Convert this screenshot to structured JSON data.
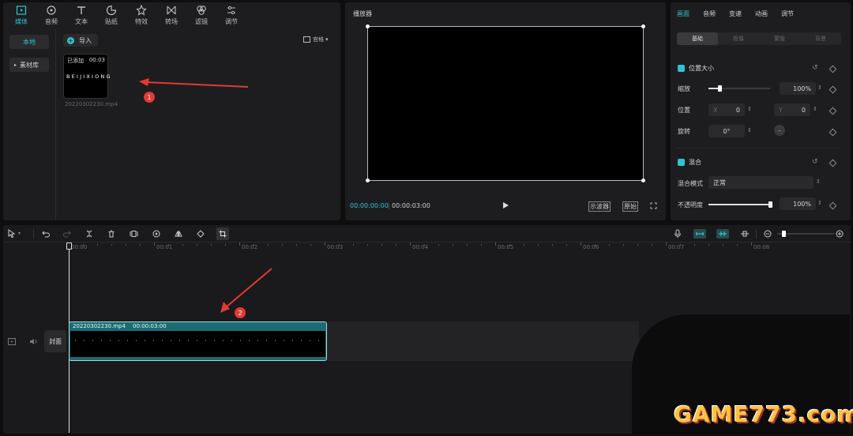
{
  "toolbar": {
    "tabs": [
      {
        "label": "媒体",
        "icon": "media-icon"
      },
      {
        "label": "音频",
        "icon": "audio-icon"
      },
      {
        "label": "文本",
        "icon": "text-icon"
      },
      {
        "label": "贴纸",
        "icon": "sticker-icon"
      },
      {
        "label": "特效",
        "icon": "effects-icon"
      },
      {
        "label": "转场",
        "icon": "transition-icon"
      },
      {
        "label": "滤镜",
        "icon": "filter-icon"
      },
      {
        "label": "调节",
        "icon": "adjust-icon"
      }
    ]
  },
  "media": {
    "sidebar": {
      "local": "本地",
      "library": "素材库"
    },
    "import_label": "导入",
    "view_label": "宫格",
    "clip": {
      "badge": "已添加",
      "duration": "00:03",
      "thumb_text": "BEIJIXIONG",
      "filename": "20220302230.mp4"
    },
    "annotation_1": "1"
  },
  "player": {
    "title": "播放器",
    "current_time": "00:00:00:00",
    "total_time": "00:00:03:00",
    "btn_scope": "示波器",
    "btn_original": "原始"
  },
  "inspector": {
    "tabs": [
      "画面",
      "音频",
      "变速",
      "动画",
      "调节"
    ],
    "subtabs": [
      "基础",
      "抠像",
      "蒙版",
      "背景"
    ],
    "section_size": "位置大小",
    "scale_label": "缩放",
    "scale_value": "100%",
    "scale_level": 0.2,
    "position_label": "位置",
    "x_label": "X",
    "x_value": "0",
    "y_label": "Y",
    "y_value": "0",
    "rotate_label": "旋转",
    "rotate_value": "0°",
    "section_blend": "混合",
    "blend_mode_label": "混合模式",
    "blend_mode_value": "正常",
    "opacity_label": "不透明度",
    "opacity_value": "100%",
    "opacity_level": 1.0
  },
  "timeline": {
    "ticks": [
      "00:00",
      "00:01",
      "00:02",
      "00:03",
      "00:04",
      "00:05",
      "00:06",
      "00:07",
      "00:08"
    ],
    "cover_label": "封面",
    "clip_name": "20220302230.mp4",
    "clip_duration": "00:00:03:00",
    "annotation_2": "2"
  },
  "watermark": "GAME773.com",
  "colors": {
    "accent": "#2ec4cf",
    "annotation": "#e53935",
    "clip": "#1b6b72"
  }
}
